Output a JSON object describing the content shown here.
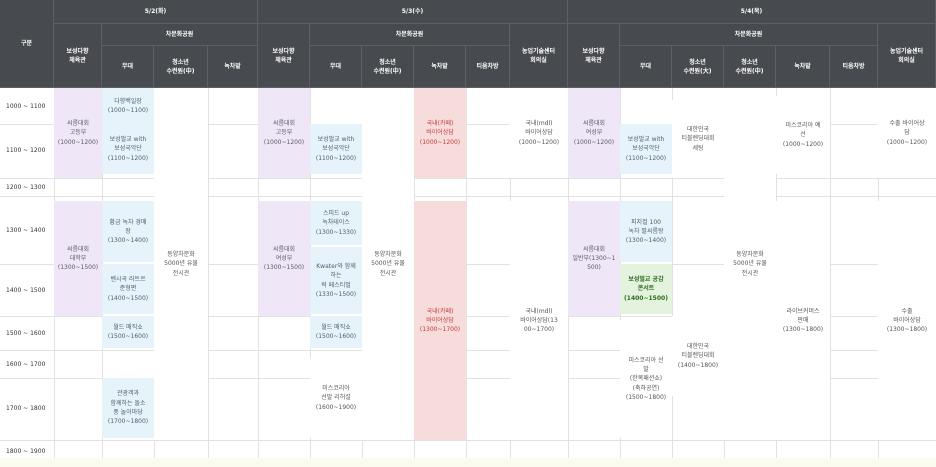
{
  "header": {
    "label_col": "구분",
    "days": [
      "5/2(화)",
      "5/3(수)",
      "5/4(목)"
    ],
    "sub_venue": "차문화공원",
    "cols": {
      "boseong_gym": "보성다향\n체육관",
      "stage": "무대",
      "youth_hall": "청소년\n수련원(中)",
      "youth_hall_large": "청소년\n수련원(大)",
      "green_tea": "녹차밭",
      "tea_vine": "녹차밭",
      "tea_gate": "티움차방",
      "agri_center": "농업기술센터\n회의실"
    }
  },
  "times": [
    "1000 ~ 1100",
    "1100 ~ 1200",
    "1200 ~ 1300",
    "1300 ~ 1400",
    "1400 ~ 1500",
    "1500 ~ 1600",
    "1600 ~ 1700",
    "1700 ~ 1800",
    "1800 ~ 1900"
  ],
  "events": {
    "d1_gym_a": "씨름대회\n고등부\n(1000~1200)",
    "d1_gym_b": "씨름대회\n대학부\n(1300~1500)",
    "d1_stage_1": "다향백일장\n(1000~1100)",
    "d1_stage_2": "보성벌교 with\n보성국악단\n(1100~1200)",
    "d1_stage_3": "황금 녹차 경매\n장\n(1300~1400)",
    "d1_stage_4": "벤시곡 러트르\n준형편\n(1400~1500)",
    "d1_stage_5": "월드 매직쇼\n(1500~1600)",
    "d1_stage_6": "관광객과\n함께하는 돌소\n풍 놀이마당\n(1700~1800)",
    "d1_youth": "동양차문화\n5000년 유물\n전시관",
    "d2_gym_a": "씨름대회\n고등부\n(1000~1200)",
    "d2_gym_b": "씨름대회\n여성부\n(1300~1500)",
    "d2_stage_1": "보성벌교 with\n보성국악단\n(1100~1200)",
    "d2_stage_2": "스피드 up\n녹차테이스\n(1300~1330)",
    "d2_stage_3": "Kwater와 함께\n하는\n락 페스티벌\n(1330~1500)",
    "d2_stage_4": "월드 매직쇼\n(1500~1600)",
    "d2_stage_5": "미스코리아\n선발 리허설\n(1600~1900)",
    "d2_youth": "동양차문화\n5000년 유물\n전시관",
    "d2_tea_a": "국내(카페)\n바이어상담\n(1000~1200)",
    "d2_tea_b": "국내(카페)\n바이어상담\n(1300~1700)",
    "d2_agri_a": "국내(mdl)\n바이어상담\n(1000~1200)",
    "d2_agri_b": "국내(mdl)\n바이어상담(13\n00~1700)",
    "d3_gym_a": "씨름대회\n여성부\n(1000~1200)",
    "d3_gym_b": "씨름대회\n일반부(1300~1\n500)",
    "d3_stage_1": "보성벌교 with\n보성국악단\n(1100~1200)",
    "d3_stage_2": "피지컬 100\n녹차 팔씨름왕\n(1300~1400)",
    "d3_stage_3": "보성벌교 공감\n콘서트\n(1400~1500)",
    "d3_stage_4": "미스코리아 선\n발\n(한복패션쇼)\n(축하공연)\n(1500~1800)",
    "d3_youth_large_a": "대한민국\n티블렌딩대회\n세팅",
    "d3_youth_large_b": "대한민국\n티블렌딩대회\n(1400~1800)",
    "d3_youth": "동양차문화\n5000년 유물\n전시관",
    "d3_tea_a": "미스코리아 예\n선\n(1000~1200)",
    "d3_tea_b": "라이브커머스\n판매\n(1300~1800)",
    "d3_agri_a": "수출 바이어상\n담\n(1000~1200)",
    "d3_agri_b": "수출\n바이어상담\n(1300~1800)"
  }
}
